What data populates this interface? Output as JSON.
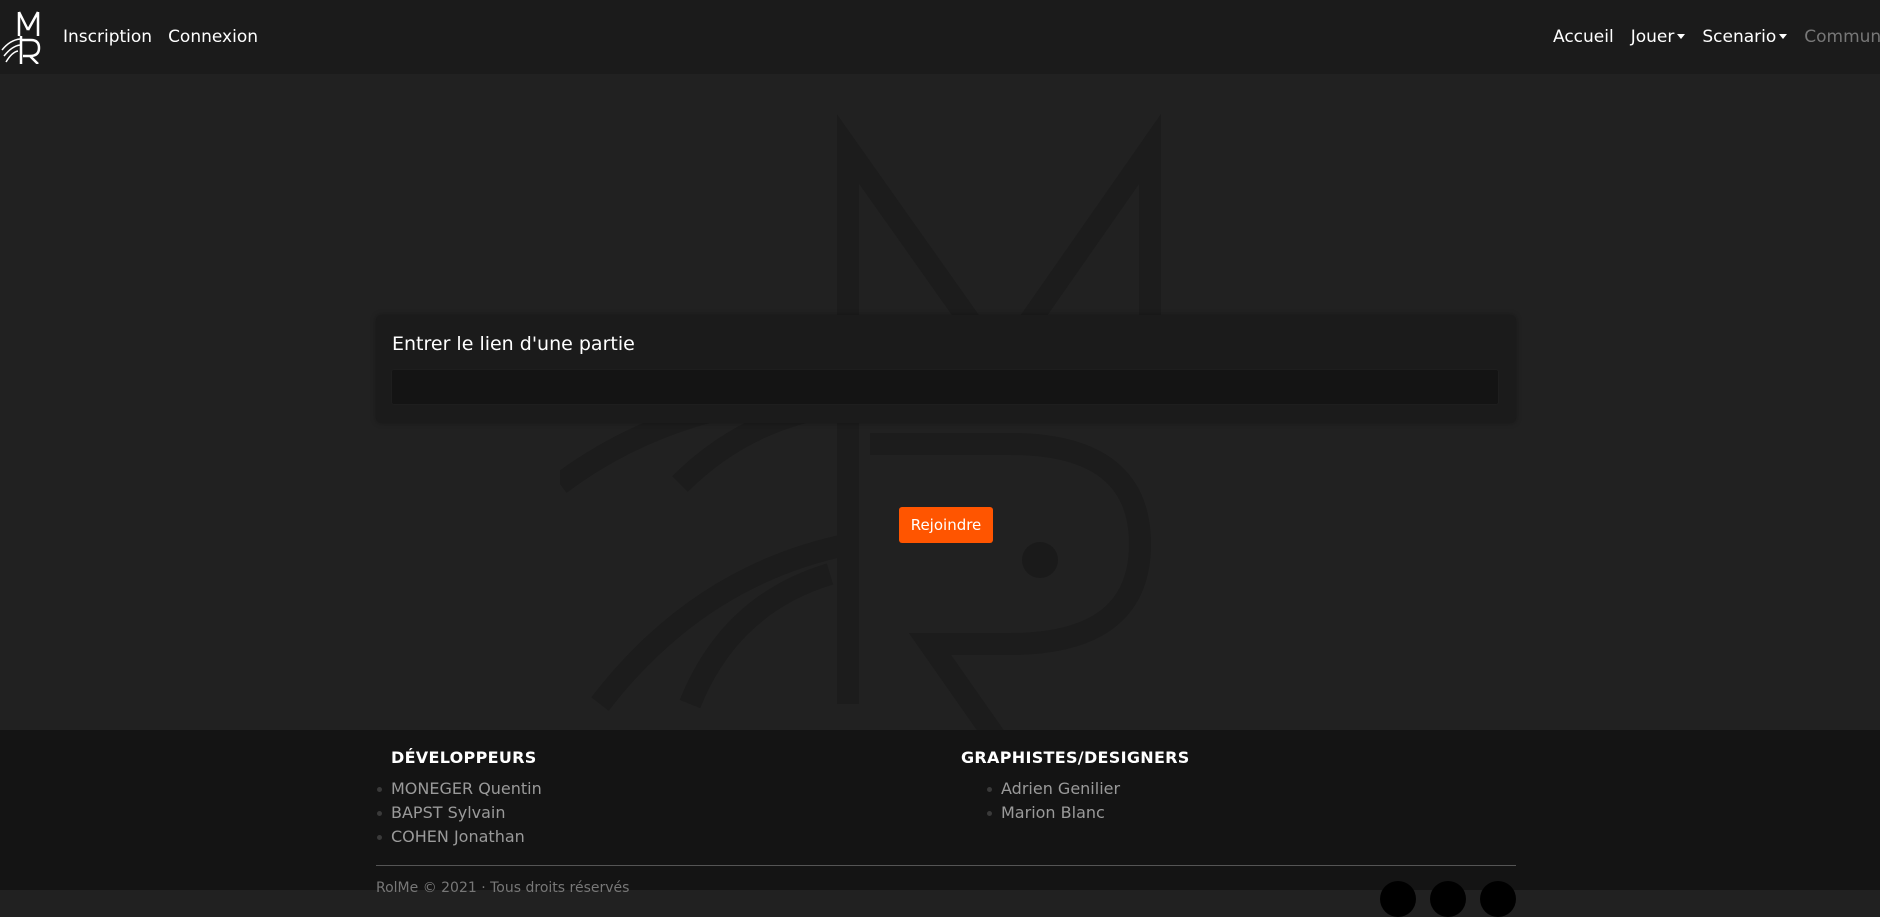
{
  "nav": {
    "left": [
      "Inscription",
      "Connexion"
    ],
    "accueil": "Accueil",
    "jouer": "Jouer",
    "scenario": "Scenario",
    "communaute": "Communauté"
  },
  "join": {
    "title": "Entrer le lien d'une partie",
    "input_value": "",
    "button": "Rejoindre"
  },
  "footer": {
    "developers": {
      "title": "DÉVELOPPEURS",
      "names": [
        "MONEGER Quentin",
        "BAPST Sylvain",
        "COHEN Jonathan"
      ]
    },
    "designers": {
      "title": "GRAPHISTES/DESIGNERS",
      "names": [
        "Adrien Genilier",
        "Marion Blanc"
      ]
    },
    "copyright": "RolMe © 2021 · Tous droits réservés"
  },
  "colors": {
    "accent": "#ff5500",
    "navbar": "#1b1b1b",
    "background": "#212121",
    "footer": "#141414"
  },
  "icons": [
    "logo-icon",
    "watermark-logo",
    "social-icon"
  ]
}
